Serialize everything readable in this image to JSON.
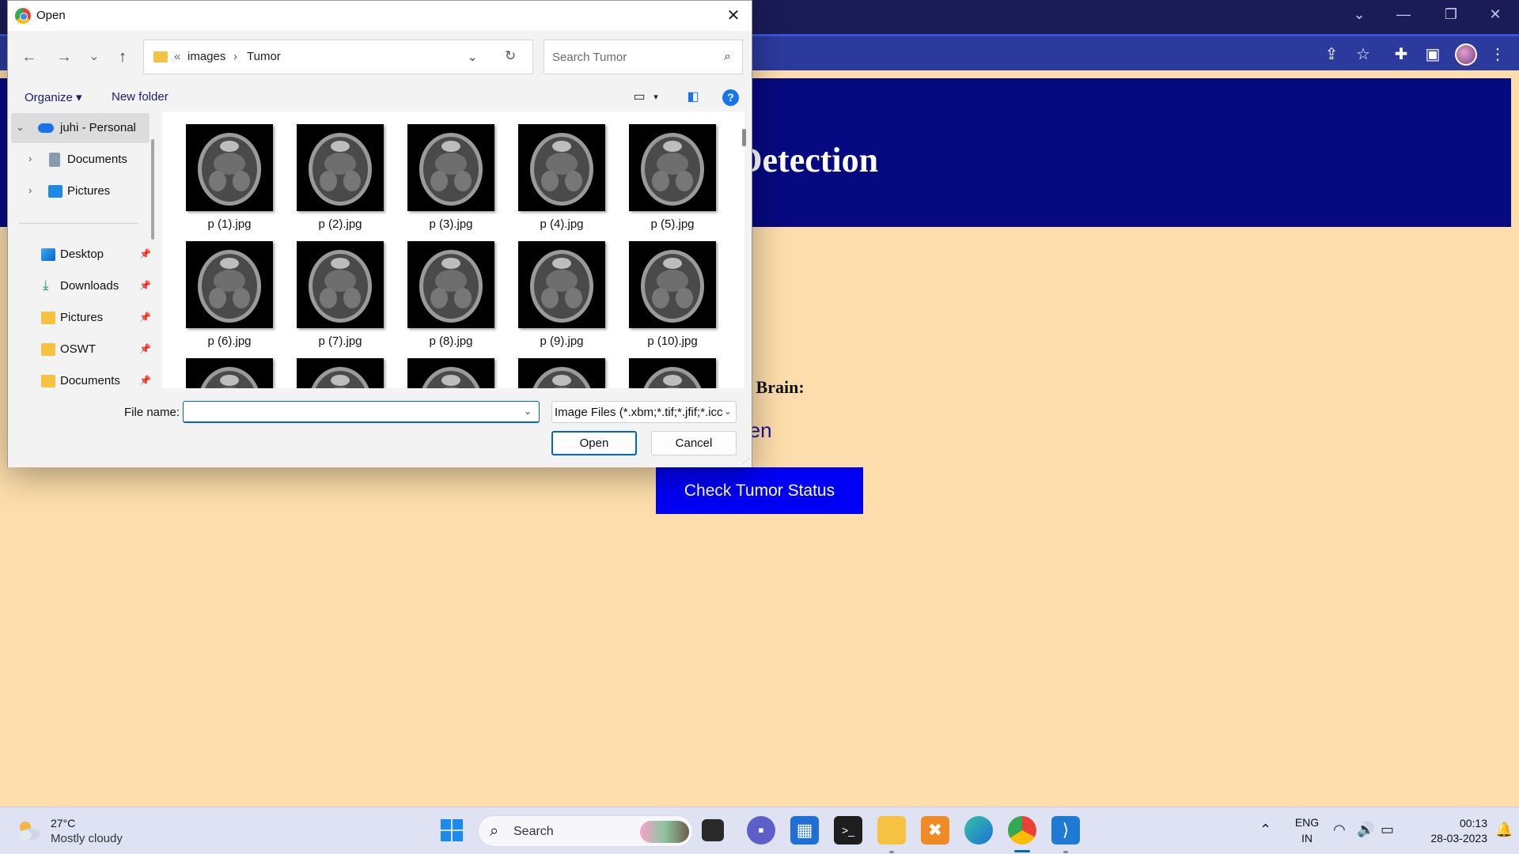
{
  "browser": {
    "window_controls": {
      "minimize": "—",
      "restore": "❐",
      "close": "✕",
      "tabs_menu": "⌄"
    }
  },
  "page": {
    "title": "or Detection",
    "upload_label": "image of Brain:",
    "file_status": "e chosen",
    "check_button": "Check Tumor Status",
    "colors": {
      "background": "#fdddab",
      "header": "#060a80",
      "button": "#0000f5"
    }
  },
  "dialog": {
    "title": "Open",
    "close": "✕",
    "nav": {
      "back": "←",
      "forward": "→",
      "recent": "⌄",
      "up": "↑"
    },
    "address": {
      "overflow": "«",
      "crumbs": [
        "images",
        "Tumor"
      ],
      "separator": "›"
    },
    "search_placeholder": "Search Tumor",
    "commands": {
      "organize": "Organize ▾",
      "new_folder": "New folder"
    },
    "nav_pane": [
      {
        "label": "juhi - Personal",
        "icon": "onedrive-icon",
        "expanded": true
      },
      {
        "label": "Documents",
        "icon": "documents-icon"
      },
      {
        "label": "Pictures",
        "icon": "pictures-icon"
      },
      {
        "label": "Desktop",
        "icon": "desktop-icon",
        "pinned": true
      },
      {
        "label": "Downloads",
        "icon": "downloads-icon",
        "pinned": true
      },
      {
        "label": "Pictures",
        "icon": "folder-icon",
        "pinned": true
      },
      {
        "label": "OSWT",
        "icon": "folder-icon",
        "pinned": true
      },
      {
        "label": "Documents",
        "icon": "folder-icon",
        "pinned": true
      }
    ],
    "files": [
      "p (1).jpg",
      "p (2).jpg",
      "p (3).jpg",
      "p (4).jpg",
      "p (5).jpg",
      "p (6).jpg",
      "p (7).jpg",
      "p (8).jpg",
      "p (9).jpg",
      "p (10).jpg"
    ],
    "file_name_label": "File name:",
    "file_name_value": "",
    "file_type": "Image Files (*.xbm;*.tif;*.jfif;*.icc",
    "open_button": "Open",
    "cancel_button": "Cancel"
  },
  "taskbar": {
    "weather": {
      "temp": "27°C",
      "desc": "Mostly cloudy"
    },
    "search_label": "Search",
    "apps": [
      "windows-start-icon",
      "task-view-icon",
      "teams-chat-icon",
      "microsoft-store-icon",
      "terminal-icon",
      "file-explorer-icon",
      "xampp-icon",
      "edge-icon",
      "chrome-icon",
      "vscode-icon"
    ],
    "language": {
      "line1": "ENG",
      "line2": "IN"
    },
    "time": "00:13",
    "date": "28-03-2023"
  }
}
